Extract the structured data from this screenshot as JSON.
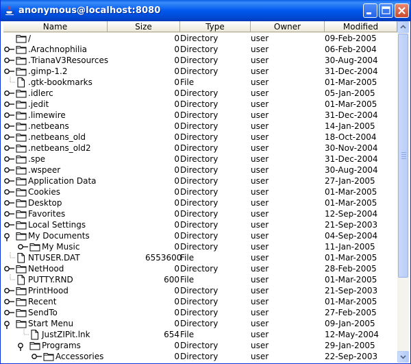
{
  "window": {
    "title": "anonymous@localhost:8080"
  },
  "columns": {
    "name": "Name",
    "size": "Size",
    "type": "Type",
    "owner": "Owner",
    "modified": "Modified"
  },
  "rows": [
    {
      "indent": 0,
      "toggle": "none",
      "icon": "folder",
      "name": "/",
      "size": "0",
      "type": "Directory",
      "owner": "user",
      "modified": "09-Feb-2005"
    },
    {
      "indent": 0,
      "toggle": "collapsed",
      "icon": "folder",
      "name": ".Arachnophilia",
      "size": "0",
      "type": "Directory",
      "owner": "user",
      "modified": "06-Feb-2004"
    },
    {
      "indent": 0,
      "toggle": "collapsed",
      "icon": "folder",
      "name": ".TrianaV3Resources",
      "size": "0",
      "type": "Directory",
      "owner": "user",
      "modified": "30-Aug-2004"
    },
    {
      "indent": 0,
      "toggle": "collapsed",
      "icon": "folder",
      "name": ".gimp-1.2",
      "size": "0",
      "type": "Directory",
      "owner": "user",
      "modified": "31-Dec-2004"
    },
    {
      "indent": 0,
      "toggle": "leaf",
      "icon": "file",
      "name": ".gtk-bookmarks",
      "size": "0",
      "type": "File",
      "owner": "user",
      "modified": "01-Mar-2005"
    },
    {
      "indent": 0,
      "toggle": "collapsed",
      "icon": "folder",
      "name": ".idlerc",
      "size": "0",
      "type": "Directory",
      "owner": "user",
      "modified": "05-Jan-2005"
    },
    {
      "indent": 0,
      "toggle": "collapsed",
      "icon": "folder",
      "name": ".jedit",
      "size": "0",
      "type": "Directory",
      "owner": "user",
      "modified": "01-Mar-2005"
    },
    {
      "indent": 0,
      "toggle": "collapsed",
      "icon": "folder",
      "name": ".limewire",
      "size": "0",
      "type": "Directory",
      "owner": "user",
      "modified": "31-Dec-2004"
    },
    {
      "indent": 0,
      "toggle": "collapsed",
      "icon": "folder",
      "name": ".netbeans",
      "size": "0",
      "type": "Directory",
      "owner": "user",
      "modified": "14-Jan-2005"
    },
    {
      "indent": 0,
      "toggle": "collapsed",
      "icon": "folder",
      "name": ".netbeans_old",
      "size": "0",
      "type": "Directory",
      "owner": "user",
      "modified": "18-Oct-2004"
    },
    {
      "indent": 0,
      "toggle": "collapsed",
      "icon": "folder",
      "name": ".netbeans_old2",
      "size": "0",
      "type": "Directory",
      "owner": "user",
      "modified": "30-Nov-2004"
    },
    {
      "indent": 0,
      "toggle": "collapsed",
      "icon": "folder",
      "name": ".spe",
      "size": "0",
      "type": "Directory",
      "owner": "user",
      "modified": "31-Dec-2004"
    },
    {
      "indent": 0,
      "toggle": "collapsed",
      "icon": "folder",
      "name": ".wspeer",
      "size": "0",
      "type": "Directory",
      "owner": "user",
      "modified": "30-Aug-2004"
    },
    {
      "indent": 0,
      "toggle": "collapsed",
      "icon": "folder",
      "name": "Application Data",
      "size": "0",
      "type": "Directory",
      "owner": "user",
      "modified": "27-Jan-2005"
    },
    {
      "indent": 0,
      "toggle": "collapsed",
      "icon": "folder",
      "name": "Cookies",
      "size": "0",
      "type": "Directory",
      "owner": "user",
      "modified": "01-Mar-2005"
    },
    {
      "indent": 0,
      "toggle": "collapsed",
      "icon": "folder",
      "name": "Desktop",
      "size": "0",
      "type": "Directory",
      "owner": "user",
      "modified": "01-Mar-2005"
    },
    {
      "indent": 0,
      "toggle": "collapsed",
      "icon": "folder",
      "name": "Favorites",
      "size": "0",
      "type": "Directory",
      "owner": "user",
      "modified": "12-Sep-2004"
    },
    {
      "indent": 0,
      "toggle": "collapsed",
      "icon": "folder",
      "name": "Local Settings",
      "size": "0",
      "type": "Directory",
      "owner": "user",
      "modified": "21-Sep-2003"
    },
    {
      "indent": 0,
      "toggle": "expanded",
      "icon": "folder",
      "name": "My Documents",
      "size": "0",
      "type": "Directory",
      "owner": "user",
      "modified": "04-Sep-2004"
    },
    {
      "indent": 1,
      "toggle": "collapsed",
      "icon": "folder",
      "name": "My Music",
      "size": "0",
      "type": "Directory",
      "owner": "user",
      "modified": "11-Jan-2005"
    },
    {
      "indent": 0,
      "toggle": "leaf",
      "icon": "file",
      "name": "NTUSER.DAT",
      "size": "6553600",
      "type": "File",
      "owner": "user",
      "modified": "01-Mar-2005"
    },
    {
      "indent": 0,
      "toggle": "collapsed",
      "icon": "folder",
      "name": "NetHood",
      "size": "0",
      "type": "Directory",
      "owner": "user",
      "modified": "28-Feb-2005"
    },
    {
      "indent": 0,
      "toggle": "leaf",
      "icon": "file",
      "name": "PUTTY.RND",
      "size": "600",
      "type": "File",
      "owner": "user",
      "modified": "01-Mar-2005"
    },
    {
      "indent": 0,
      "toggle": "collapsed",
      "icon": "folder",
      "name": "PrintHood",
      "size": "0",
      "type": "Directory",
      "owner": "user",
      "modified": "21-Sep-2003"
    },
    {
      "indent": 0,
      "toggle": "collapsed",
      "icon": "folder",
      "name": "Recent",
      "size": "0",
      "type": "Directory",
      "owner": "user",
      "modified": "01-Mar-2005"
    },
    {
      "indent": 0,
      "toggle": "collapsed",
      "icon": "folder",
      "name": "SendTo",
      "size": "0",
      "type": "Directory",
      "owner": "user",
      "modified": "27-Feb-2005"
    },
    {
      "indent": 0,
      "toggle": "expanded",
      "icon": "folder",
      "name": "Start Menu",
      "size": "0",
      "type": "Directory",
      "owner": "user",
      "modified": "09-Jan-2005"
    },
    {
      "indent": 1,
      "toggle": "leaf",
      "icon": "file",
      "name": "JustZIPit.lnk",
      "size": "654",
      "type": "File",
      "owner": "user",
      "modified": "12-May-2004"
    },
    {
      "indent": 1,
      "toggle": "expanded",
      "icon": "folder",
      "name": "Programs",
      "size": "0",
      "type": "Directory",
      "owner": "user",
      "modified": "29-Jan-2005"
    },
    {
      "indent": 2,
      "toggle": "collapsed",
      "icon": "folder",
      "name": "Accessories",
      "size": "0",
      "type": "Directory",
      "owner": "user",
      "modified": "22-Sep-2003"
    }
  ]
}
